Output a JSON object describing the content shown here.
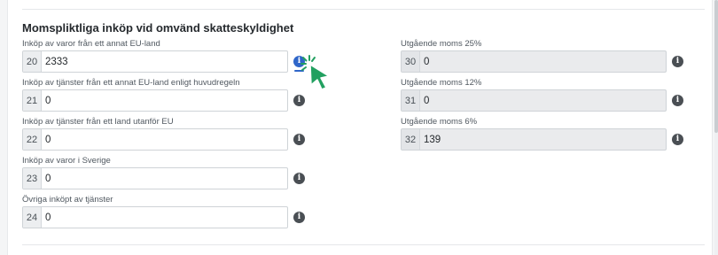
{
  "section": {
    "title": "Momspliktliga inköp vid omvänd skatteskyldighet"
  },
  "left_fields": [
    {
      "code": "20",
      "label": "Inköp av varor från ett annat EU-land",
      "value": "2333"
    },
    {
      "code": "21",
      "label": "Inköp av tjänster från ett annat EU-land enligt huvudregeln",
      "value": "0"
    },
    {
      "code": "22",
      "label": "Inköp av tjänster från ett land utanför EU",
      "value": "0"
    },
    {
      "code": "23",
      "label": "Inköp av varor i Sverige",
      "value": "0"
    },
    {
      "code": "24",
      "label": "Övriga inköpt av tjänster",
      "value": "0"
    }
  ],
  "right_fields": [
    {
      "code": "30",
      "label": "Utgående moms 25%",
      "value": "0"
    },
    {
      "code": "31",
      "label": "Utgående moms 12%",
      "value": "0"
    },
    {
      "code": "32",
      "label": "Utgående moms 6%",
      "value": "139"
    }
  ],
  "icons": {
    "info": "info-icon",
    "cursor": "mouse-pointer-icon"
  },
  "colors": {
    "info_active": "#2f66c9",
    "info_default": "#4a4f54",
    "cursor": "#22a060",
    "readonly_field": "#eaebed"
  }
}
